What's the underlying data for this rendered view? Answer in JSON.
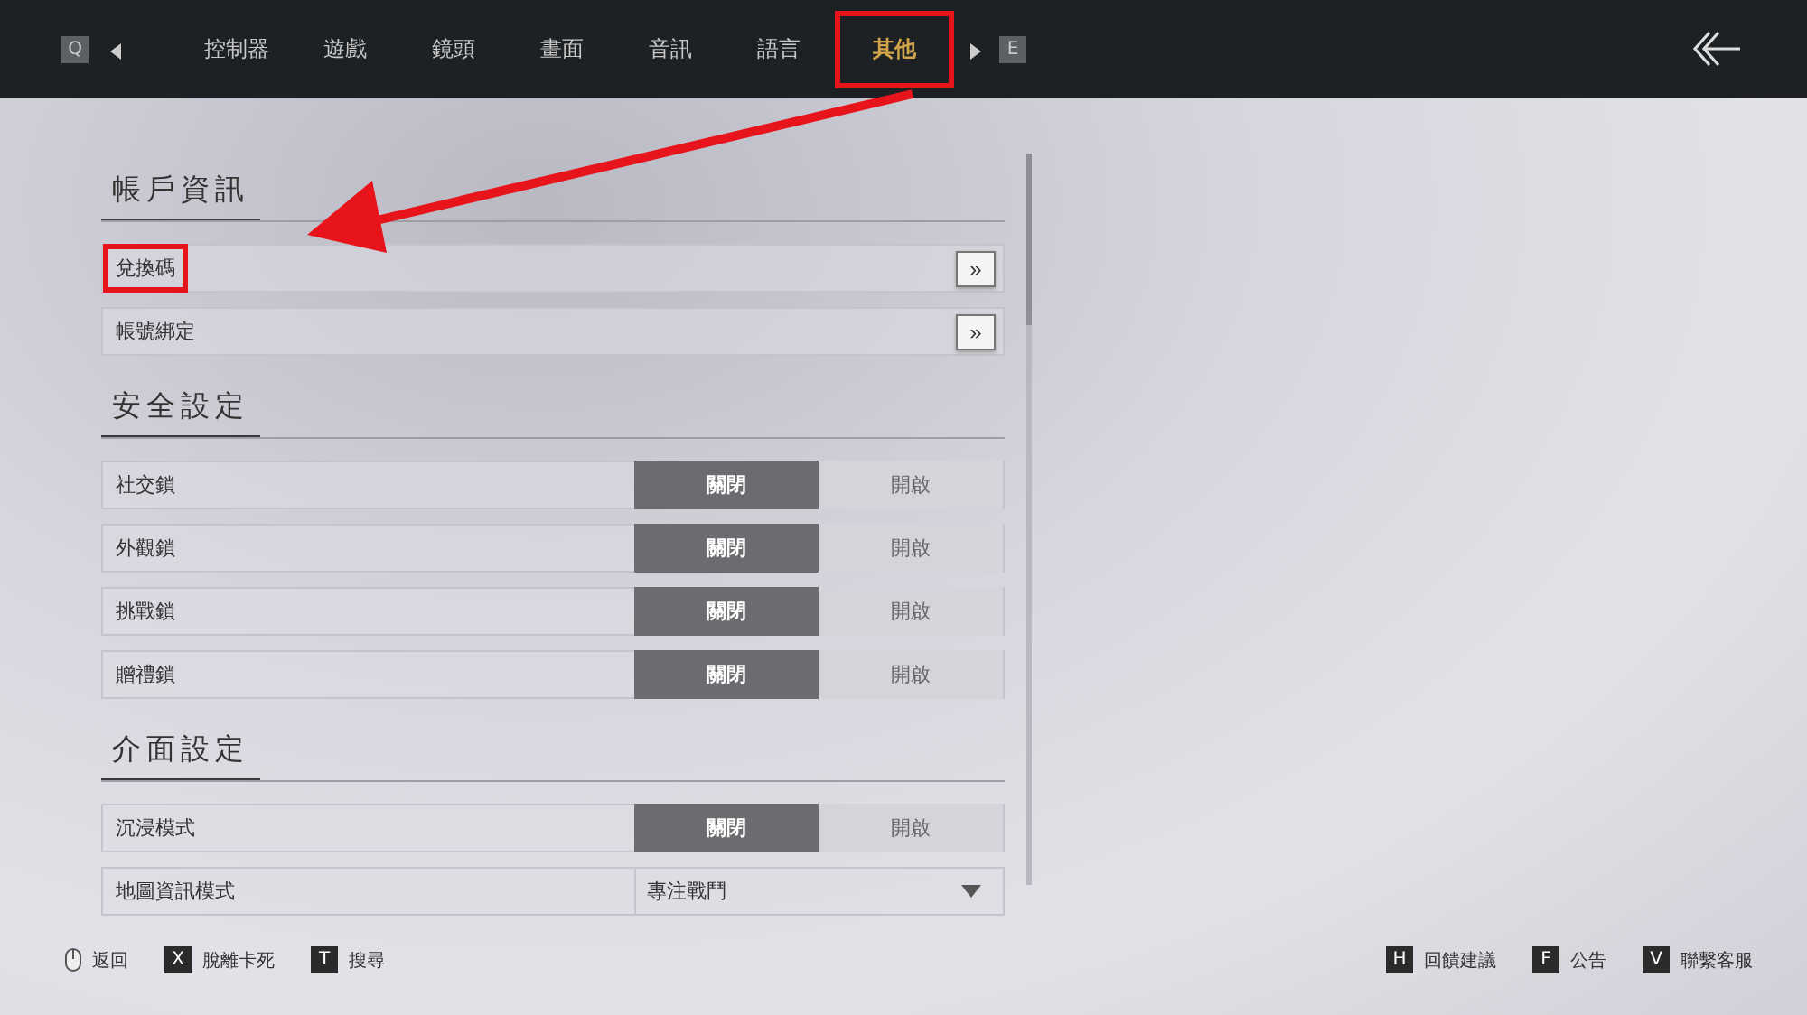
{
  "top_bar": {
    "prev_key": "Q",
    "next_key": "E",
    "tabs": [
      {
        "label": "控制器",
        "selected": false,
        "highlighted": false
      },
      {
        "label": "遊戲",
        "selected": false,
        "highlighted": false
      },
      {
        "label": "鏡頭",
        "selected": false,
        "highlighted": false
      },
      {
        "label": "畫面",
        "selected": false,
        "highlighted": false
      },
      {
        "label": "音訊",
        "selected": false,
        "highlighted": false
      },
      {
        "label": "語言",
        "selected": false,
        "highlighted": false
      },
      {
        "label": "其他",
        "selected": true,
        "highlighted": true
      }
    ]
  },
  "sections": [
    {
      "title": "帳戶資訊",
      "rows": [
        {
          "kind": "link",
          "label": "兌換碼",
          "button": "»",
          "highlighted": true
        },
        {
          "kind": "link",
          "label": "帳號綁定",
          "button": "»",
          "highlighted": false
        }
      ]
    },
    {
      "title": "安全設定",
      "rows": [
        {
          "kind": "toggle",
          "label": "社交鎖",
          "options": [
            {
              "label": "關閉",
              "selected": true
            },
            {
              "label": "開啟",
              "selected": false
            }
          ]
        },
        {
          "kind": "toggle",
          "label": "外觀鎖",
          "options": [
            {
              "label": "關閉",
              "selected": true
            },
            {
              "label": "開啟",
              "selected": false
            }
          ]
        },
        {
          "kind": "toggle",
          "label": "挑戰鎖",
          "options": [
            {
              "label": "關閉",
              "selected": true
            },
            {
              "label": "開啟",
              "selected": false
            }
          ]
        },
        {
          "kind": "toggle",
          "label": "贈禮鎖",
          "options": [
            {
              "label": "關閉",
              "selected": true
            },
            {
              "label": "開啟",
              "selected": false
            }
          ]
        }
      ]
    },
    {
      "title": "介面設定",
      "rows": [
        {
          "kind": "toggle",
          "label": "沉浸模式",
          "options": [
            {
              "label": "關閉",
              "selected": true
            },
            {
              "label": "開啟",
              "selected": false
            }
          ]
        },
        {
          "kind": "dropdown",
          "label": "地圖資訊模式",
          "value": "專注戰鬥"
        }
      ]
    }
  ],
  "footer": {
    "left": [
      {
        "kind": "mouse",
        "label": "返回"
      },
      {
        "kind": "key",
        "key": "X",
        "label": "脫離卡死"
      },
      {
        "kind": "key",
        "key": "T",
        "label": "搜尋"
      }
    ],
    "right": [
      {
        "kind": "key",
        "key": "H",
        "label": "回饋建議"
      },
      {
        "kind": "key",
        "key": "F",
        "label": "公告"
      },
      {
        "kind": "key",
        "key": "V",
        "label": "聯繫客服"
      }
    ]
  }
}
